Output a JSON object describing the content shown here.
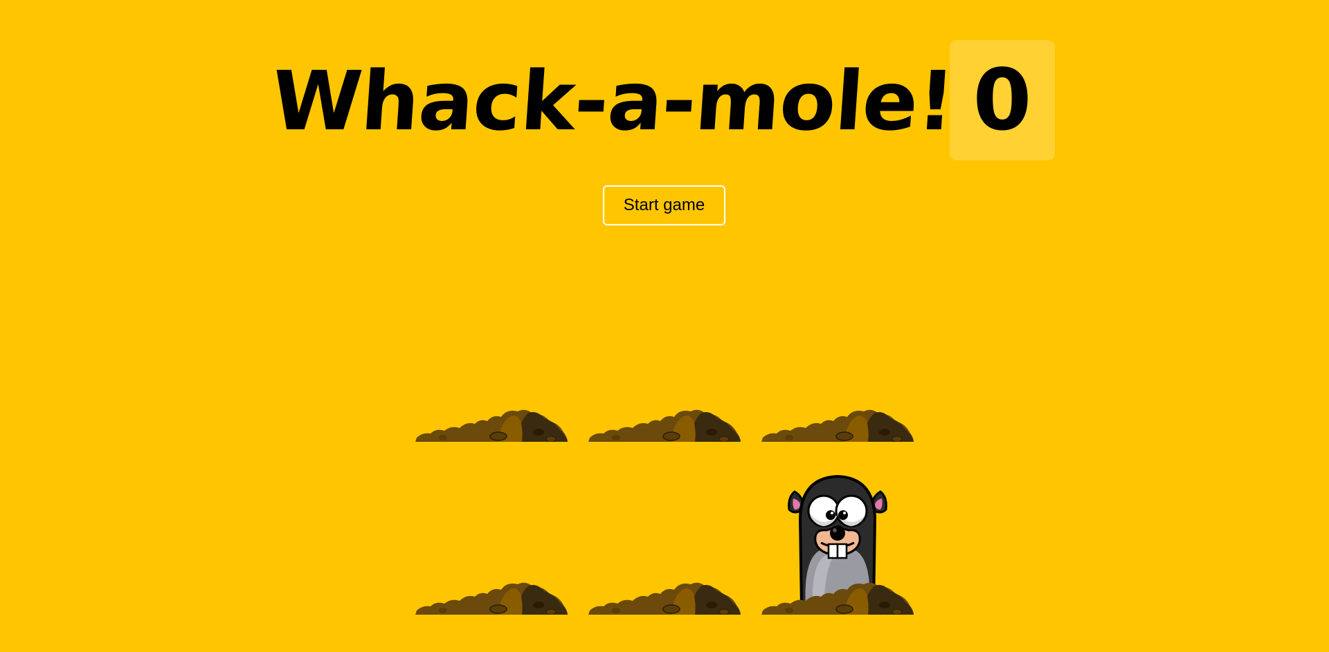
{
  "game": {
    "title": "Whack-a-mole!",
    "score": "0",
    "start_label": "Start game"
  },
  "holes": [
    {
      "mole_visible": false
    },
    {
      "mole_visible": false
    },
    {
      "mole_visible": false
    },
    {
      "mole_visible": false
    },
    {
      "mole_visible": false
    },
    {
      "mole_visible": true
    }
  ],
  "colors": {
    "background": "#ffc600",
    "dirt_dark": "#3a2a10",
    "dirt_mid": "#6b4a0c",
    "dirt_light": "#8a5c00",
    "mole_body": "#2b2b2b",
    "mole_belly": "#9a9aa2"
  }
}
